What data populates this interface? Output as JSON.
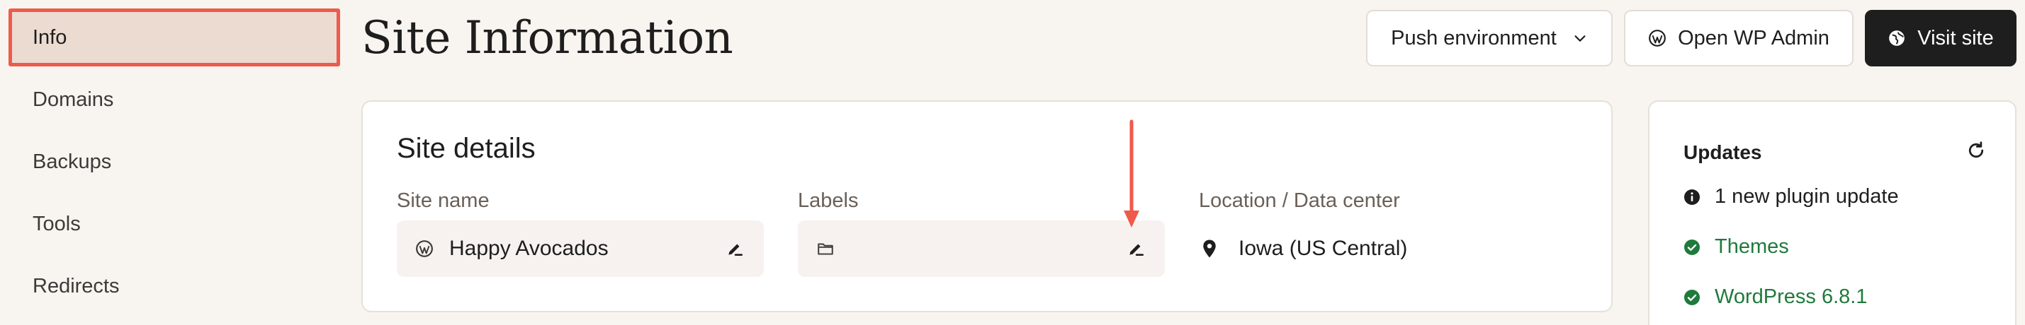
{
  "sidebar": {
    "items": [
      {
        "label": "Info",
        "active": true
      },
      {
        "label": "Domains"
      },
      {
        "label": "Backups"
      },
      {
        "label": "Tools"
      },
      {
        "label": "Redirects"
      }
    ]
  },
  "header": {
    "title": "Site Information",
    "push_label": "Push environment",
    "wp_admin_label": "Open WP Admin",
    "visit_label": "Visit site"
  },
  "site_details": {
    "title": "Site details",
    "site_name_label": "Site name",
    "site_name_value": "Happy Avocados",
    "labels_label": "Labels",
    "labels_value": "",
    "location_label": "Location / Data center",
    "location_value": "Iowa (US Central)"
  },
  "updates": {
    "title": "Updates",
    "items": [
      {
        "label": "1 new plugin update",
        "status": "info"
      },
      {
        "label": "Themes",
        "status": "ok"
      },
      {
        "label": "WordPress 6.8.1",
        "status": "ok"
      }
    ]
  },
  "colors": {
    "accent_highlight": "#ee5a4c",
    "active_nav_bg": "#ebdbd1",
    "success_green": "#1f7a3c",
    "dark_button": "#1e1e1e",
    "page_bg": "#f8f4f0"
  },
  "icons": {
    "push_chevron": "chevron-down-icon",
    "wp_admin": "wordpress-icon",
    "visit_site": "globe-icon",
    "site_name_lead": "wordpress-icon",
    "edit": "pencil-icon",
    "labels_lead": "folder-icon",
    "location": "map-pin-icon",
    "refresh": "refresh-icon",
    "info": "info-icon",
    "ok": "check-circle-icon"
  }
}
